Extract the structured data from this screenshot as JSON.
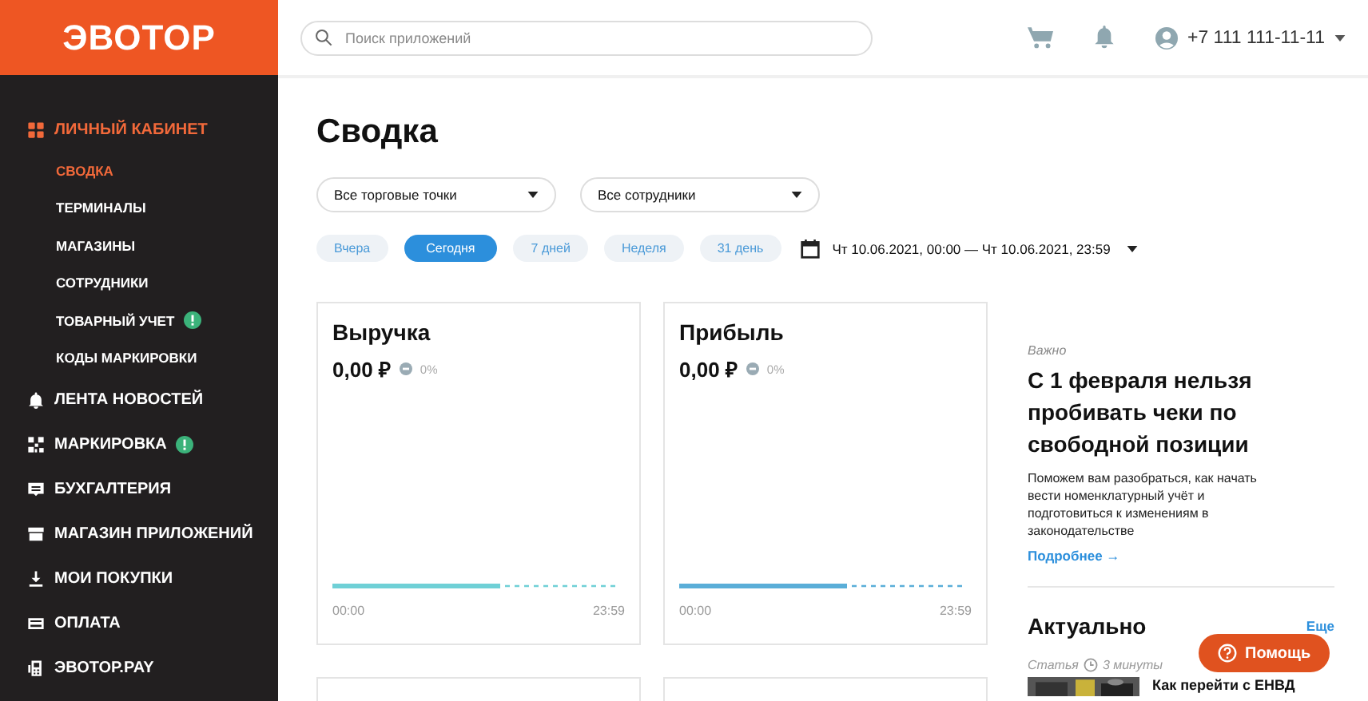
{
  "logo": "ЭВОТОР",
  "search": {
    "placeholder": "Поиск приложений"
  },
  "account": {
    "phone": "+7 111 111-11-11"
  },
  "sidebar": {
    "items": [
      {
        "label": "ЛИЧНЫЙ КАБИНЕТ",
        "selected": true,
        "alert": false,
        "children": [
          {
            "label": "СВОДКА",
            "selected": true,
            "alert": false
          },
          {
            "label": "ТЕРМИНАЛЫ",
            "selected": false,
            "alert": false
          },
          {
            "label": "МАГАЗИНЫ",
            "selected": false,
            "alert": false
          },
          {
            "label": "СОТРУДНИКИ",
            "selected": false,
            "alert": false
          },
          {
            "label": "ТОВАРНЫЙ УЧЕТ",
            "selected": false,
            "alert": true
          },
          {
            "label": "КОДЫ МАРКИРОВКИ",
            "selected": false,
            "alert": false
          }
        ]
      },
      {
        "label": "ЛЕНТА НОВОСТЕЙ",
        "selected": false,
        "alert": false
      },
      {
        "label": "МАРКИРОВКА",
        "selected": false,
        "alert": true
      },
      {
        "label": "БУХГАЛТЕРИЯ",
        "selected": false,
        "alert": false
      },
      {
        "label": "МАГАЗИН ПРИЛОЖЕНИЙ",
        "selected": false,
        "alert": false
      },
      {
        "label": "МОИ ПОКУПКИ",
        "selected": false,
        "alert": false
      },
      {
        "label": "ОПЛАТА",
        "selected": false,
        "alert": false
      },
      {
        "label": "ЭВОТОР.PAY",
        "selected": false,
        "alert": false
      }
    ]
  },
  "page_title": "Сводка",
  "filters": [
    {
      "value": "Все торговые точки"
    },
    {
      "value": "Все сотрудники"
    }
  ],
  "periods": [
    {
      "label": "Вчера",
      "selected": false
    },
    {
      "label": "Сегодня",
      "selected": true
    },
    {
      "label": "7 дней",
      "selected": false
    },
    {
      "label": "Неделя",
      "selected": false
    },
    {
      "label": "31 день",
      "selected": false
    }
  ],
  "date_range": "Чт 10.06.2021, 00:00 — Чт 10.06.2021, 23:59",
  "cards": [
    {
      "title": "Выручка",
      "value": "0,00 ₽",
      "change": "0%",
      "start": "00:00",
      "end": "23:59",
      "color": "#6fd0d6"
    },
    {
      "title": "Прибыль",
      "value": "0,00 ₽",
      "change": "0%",
      "start": "00:00",
      "end": "23:59",
      "color": "#5aaed8"
    }
  ],
  "news": {
    "tag": "Важно",
    "title": "С 1 февраля нельзя пробивать чеки по свободной позиции",
    "text": "Поможем вам разобраться, как начать вести номенклатурный учёт и подготовиться к изменениям в законодательстве",
    "link": "Подробнее →"
  },
  "actual": {
    "title": "Актуально",
    "more": "Еще",
    "article": {
      "type": "Статья",
      "duration": "3 минуты",
      "title": "Как перейти с ЕНВД"
    }
  },
  "help_button": "Помощь"
}
